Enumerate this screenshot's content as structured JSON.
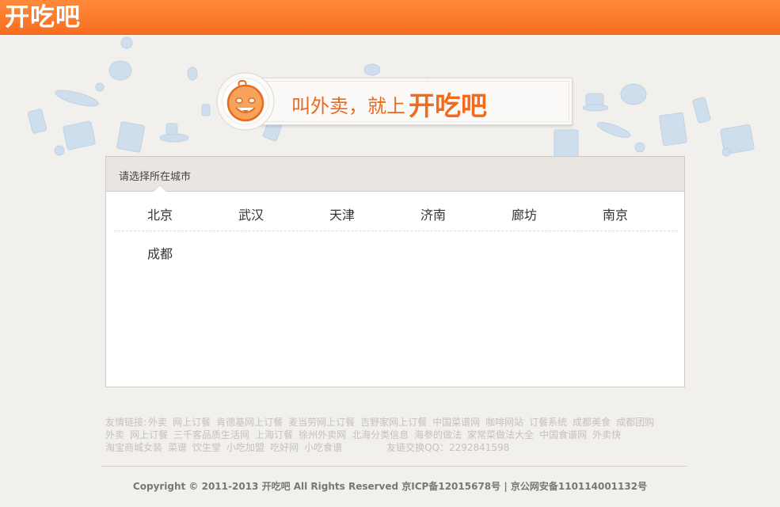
{
  "header": {
    "logo_text": "开吃吧",
    "bg_color": "#f97325"
  },
  "banner": {
    "slogan": "叫外卖，就上",
    "brand": "开吃吧"
  },
  "city_panel": {
    "title": "请选择所在城市",
    "cities_row1": [
      "北京",
      "武汉",
      "天津",
      "济南",
      "廊坊",
      "南京"
    ],
    "cities_row2": [
      "成都"
    ]
  },
  "footer": {
    "friend_links_label": "友情链接:",
    "friend_links": [
      "外卖",
      "网上订餐",
      "肯德基网上订餐",
      "麦当劳网上订餐",
      "吉野家网上订餐",
      "中国菜谱网",
      "咖啡网站",
      "订餐系统",
      "成都美食",
      "成都团购",
      "外卖",
      "网上订餐",
      "三千客品质生活网",
      "上海订餐",
      "徐州外卖网",
      "北海分类信息",
      "海参的做法",
      "家常菜做法大全",
      "中国食谱网",
      "外卖快",
      "淘宝商城女装",
      "菜谱",
      "饮生堂",
      "小吃加盟",
      "吃好网",
      "小吃食谱"
    ],
    "link_exchange": "友链交换QQ：2292841598",
    "copyright": "Copyright © 2011-2013 开吃吧 All Rights Reserved 京ICP备12015678号 | 京公网安备110114001132号"
  }
}
